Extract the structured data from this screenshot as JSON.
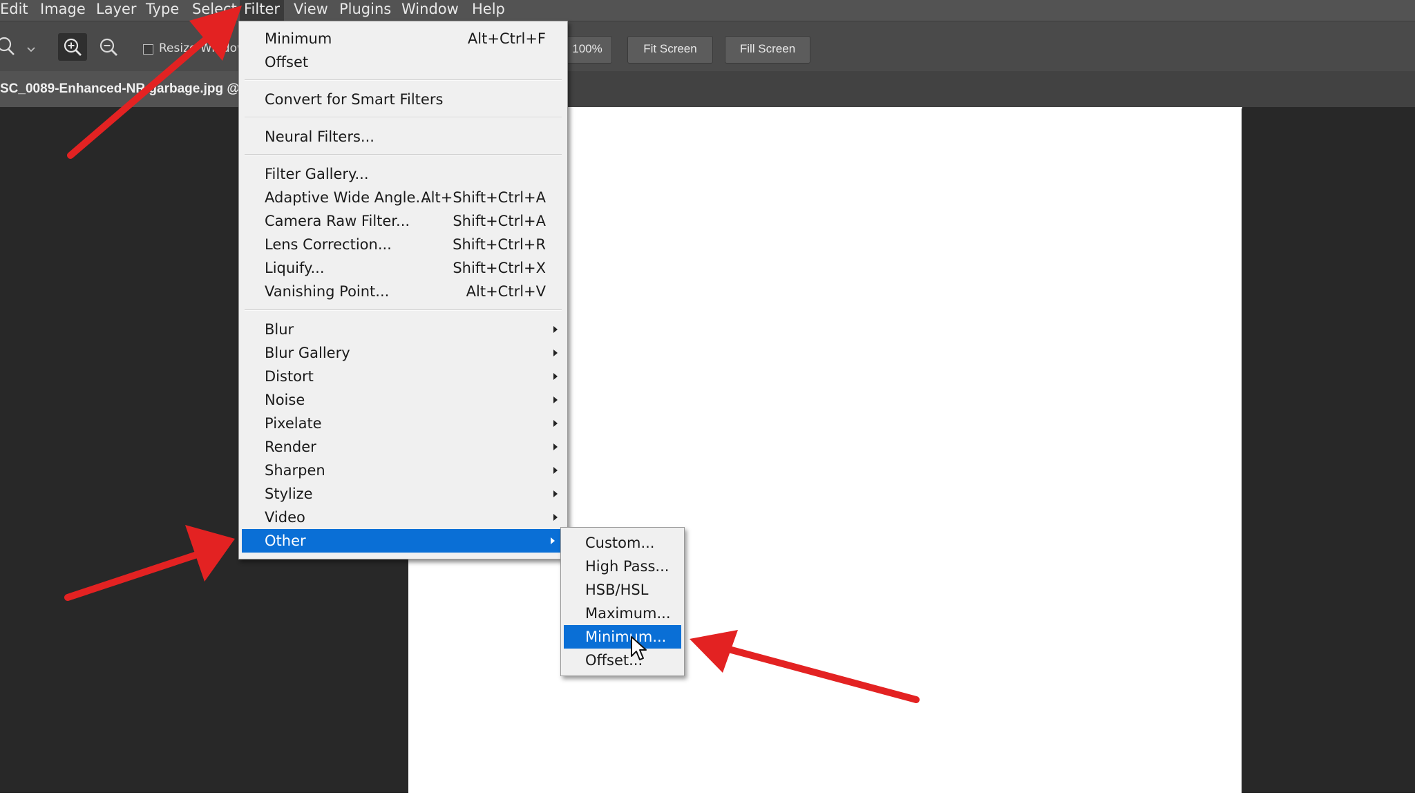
{
  "colors": {
    "menubar": "#535353",
    "optionsbar": "#4a4a4a",
    "workspace": "#282828",
    "menu_bg": "#f0f0f0",
    "highlight": "#0a6fd6",
    "annotation_arrow": "#e32222"
  },
  "menubar": {
    "items": [
      {
        "label": "Edit"
      },
      {
        "label": "Image"
      },
      {
        "label": "Layer"
      },
      {
        "label": "Type"
      },
      {
        "label": "Select"
      },
      {
        "label": "Filter"
      },
      {
        "label": "View"
      },
      {
        "label": "Plugins"
      },
      {
        "label": "Window"
      },
      {
        "label": "Help"
      }
    ]
  },
  "optionsbar": {
    "resize_label": "Resize Windows",
    "btn_zoom100": "100%",
    "btn_fit": "Fit Screen",
    "btn_fill": "Fill Screen"
  },
  "document": {
    "tab_title": "SC_0089-Enhanced-NR garbage.jpg @"
  },
  "filter_menu": {
    "last_filter": {
      "label": "Minimum",
      "shortcut": "Alt+Ctrl+F"
    },
    "fade": {
      "label": "Offset"
    },
    "convert": {
      "label": "Convert for Smart Filters"
    },
    "neural": {
      "label": "Neural Filters..."
    },
    "gallery": {
      "label": "Filter Gallery..."
    },
    "adaptive": {
      "label": "Adaptive Wide Angle...",
      "shortcut": "Alt+Shift+Ctrl+A"
    },
    "camera_raw": {
      "label": "Camera Raw Filter...",
      "shortcut": "Shift+Ctrl+A"
    },
    "lens": {
      "label": "Lens Correction...",
      "shortcut": "Shift+Ctrl+R"
    },
    "liquify": {
      "label": "Liquify...",
      "shortcut": "Shift+Ctrl+X"
    },
    "vanishing": {
      "label": "Vanishing Point...",
      "shortcut": "Alt+Ctrl+V"
    },
    "submenus": [
      {
        "label": "Blur"
      },
      {
        "label": "Blur Gallery"
      },
      {
        "label": "Distort"
      },
      {
        "label": "Noise"
      },
      {
        "label": "Pixelate"
      },
      {
        "label": "Render"
      },
      {
        "label": "Sharpen"
      },
      {
        "label": "Stylize"
      },
      {
        "label": "Video"
      },
      {
        "label": "Other"
      }
    ]
  },
  "other_submenu": {
    "items": [
      {
        "label": "Custom..."
      },
      {
        "label": "High Pass..."
      },
      {
        "label": "HSB/HSL"
      },
      {
        "label": "Maximum..."
      },
      {
        "label": "Minimum..."
      },
      {
        "label": "Offset..."
      }
    ]
  }
}
